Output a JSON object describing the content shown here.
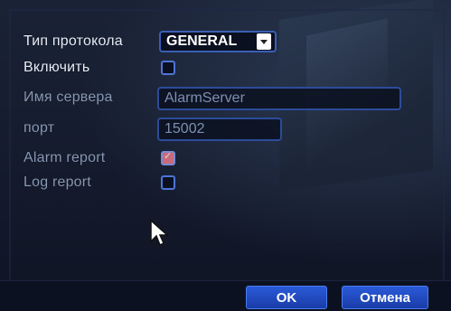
{
  "form": {
    "protocol_label": "Тип протокола",
    "protocol_value": "GENERAL",
    "enable_label": "Включить",
    "enable_checked": false,
    "server_label": "Имя сервера",
    "server_value": "AlarmServer",
    "port_label": "порт",
    "port_value": "15002",
    "alarm_report_label": "Alarm report",
    "alarm_report_checked": true,
    "log_report_label": "Log report",
    "log_report_checked": false
  },
  "buttons": {
    "ok_label": "OK",
    "cancel_label": "Отмена"
  },
  "colors": {
    "accent": "#2a5ad8",
    "field_border": "#2c4c9a",
    "checked_fill": "#c86a7a"
  }
}
